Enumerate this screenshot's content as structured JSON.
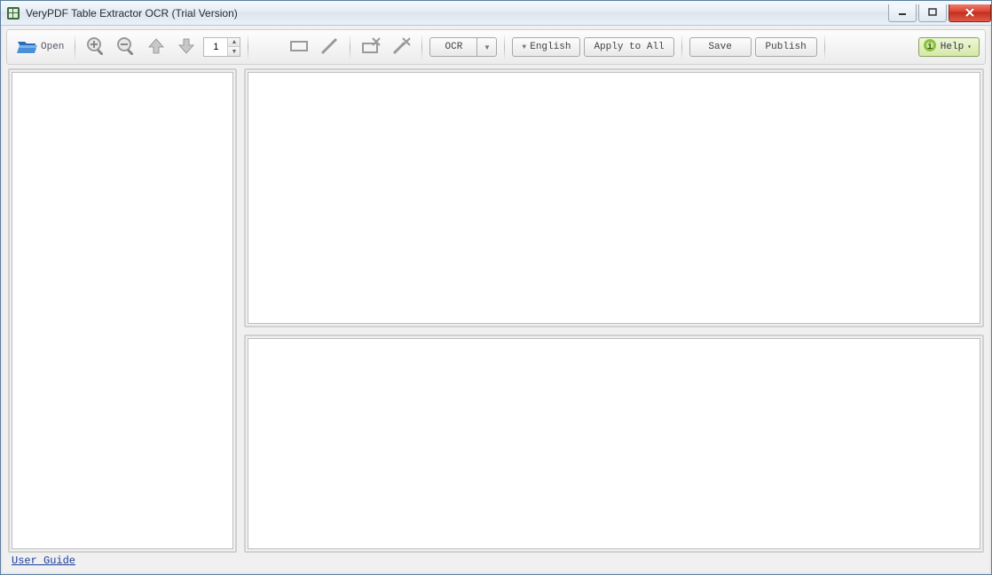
{
  "window": {
    "title": "VeryPDF Table Extractor OCR (Trial Version)"
  },
  "toolbar": {
    "open_label": "Open",
    "page_value": "1",
    "ocr_label": "OCR",
    "language_label": "English",
    "apply_all_label": "Apply to All",
    "save_label": "Save",
    "publish_label": "Publish",
    "help_label": "Help"
  },
  "footer": {
    "user_guide_label": "User Guide"
  }
}
